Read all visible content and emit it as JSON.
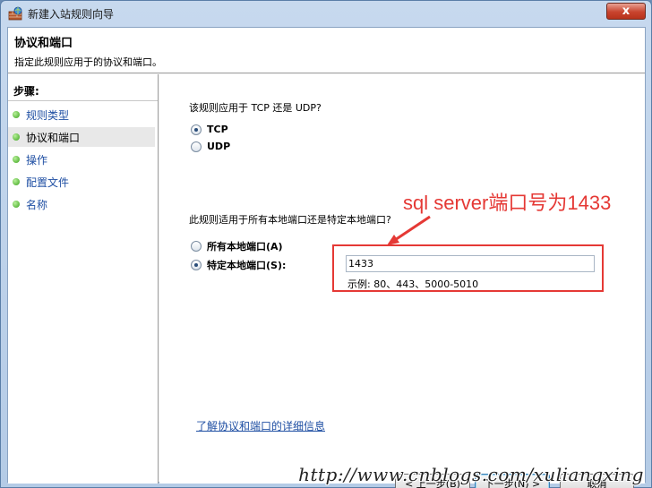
{
  "window": {
    "title": "新建入站规则向导",
    "close_glyph": "x"
  },
  "header": {
    "title": "协议和端口",
    "subtitle": "指定此规则应用于的协议和端口。"
  },
  "sidebar": {
    "steps_label": "步骤:",
    "items": [
      {
        "label": "规则类型",
        "current": false
      },
      {
        "label": "协议和端口",
        "current": true
      },
      {
        "label": "操作",
        "current": false
      },
      {
        "label": "配置文件",
        "current": false
      },
      {
        "label": "名称",
        "current": false
      }
    ]
  },
  "main": {
    "protocol_question": "该规则应用于 TCP 还是 UDP?",
    "protocol_options": [
      {
        "label": "TCP",
        "checked": true
      },
      {
        "label": "UDP",
        "checked": false
      }
    ],
    "port_question": "此规则适用于所有本地端口还是特定本地端口?",
    "port_options": [
      {
        "label": "所有本地端口(A)",
        "checked": false
      },
      {
        "label": "特定本地端口(S):",
        "checked": true
      }
    ],
    "port_value": "1433",
    "port_example": "示例: 80、443、5000-5010",
    "annotation": "sql server端口号为1433",
    "more_info_link": "了解协议和端口的详细信息"
  },
  "buttons": {
    "back": "< 上一步(B)",
    "next": "下一步(N) >",
    "cancel": "取消"
  },
  "watermark": "http://www.cnblogs.com/xuliangxing",
  "colors": {
    "annotation_red": "#e53935",
    "link_blue": "#1f4fa3",
    "step_dot_green": "#3aa31c"
  }
}
